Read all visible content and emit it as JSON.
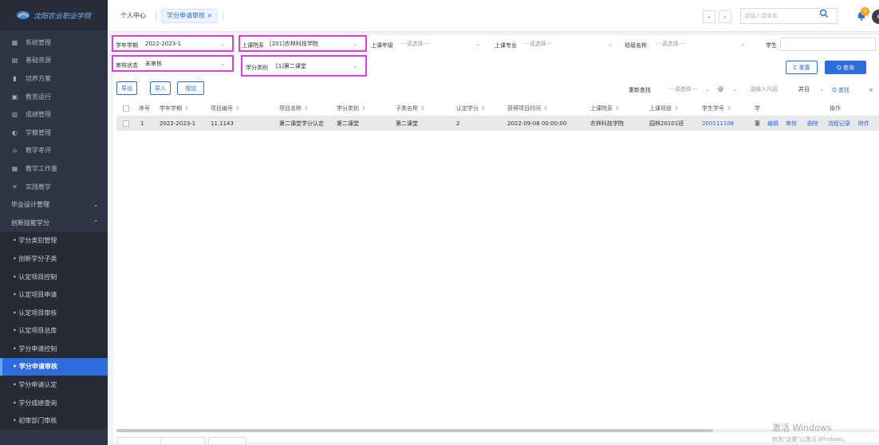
{
  "sidebar": {
    "logo_text": "沈阳农业职业学院",
    "items": [
      {
        "label": "系统管理",
        "icon": "settings-icon"
      },
      {
        "label": "基础资源",
        "icon": "database-icon"
      },
      {
        "label": "培养方案",
        "icon": "book-icon"
      },
      {
        "label": "教务运行",
        "icon": "monitor-icon"
      },
      {
        "label": "成绩管理",
        "icon": "score-icon"
      },
      {
        "label": "学籍管理",
        "icon": "student-icon"
      },
      {
        "label": "教学考评",
        "icon": "home-icon"
      },
      {
        "label": "教学工作量",
        "icon": "chart-icon"
      },
      {
        "label": "实践教学",
        "icon": "practice-icon"
      }
    ],
    "groups": [
      {
        "label": "毕业设计管理",
        "chevron": "chevron-down-icon"
      },
      {
        "label": "创新技能学分",
        "chevron": "chevron-up-icon"
      }
    ],
    "subitems": [
      {
        "label": "• 学分类别管理"
      },
      {
        "label": "• 创新学分子类"
      },
      {
        "label": "• 认定项目控制"
      },
      {
        "label": "• 认定项目申请"
      },
      {
        "label": "• 认定项目审核"
      },
      {
        "label": "• 认定项目总库"
      },
      {
        "label": "• 学分申请控制"
      },
      {
        "label": "• 学分申请审核"
      },
      {
        "label": "• 学分申请认定"
      },
      {
        "label": "• 学分成绩查询"
      },
      {
        "label": "• 初审部门审核"
      }
    ],
    "active_subitem": "• 学分申请审核"
  },
  "topbar": {
    "tabs": [
      {
        "label": "个人中心"
      },
      {
        "label": "学分申请审核 ×"
      }
    ],
    "menu_search_placeholder": "请输入菜单名",
    "notification_count": "0",
    "avatar": "e"
  },
  "filters": {
    "term_label": "学年学期",
    "term_value": "2022-2023-1",
    "college_label": "上课院系",
    "college_value": "[201]农林科技学院",
    "grade_label": "上课年级",
    "grade_value": "---请选择---",
    "major_label": "上课专业",
    "major_value": "---请选择---",
    "class_label": "班级名称",
    "class_value": "---请选择---",
    "student_label": "学生",
    "status_label": "审核状态",
    "status_value": "未审核",
    "category_label": "学分类别",
    "category_value": "[1]第二课堂",
    "reset_label": "C 重置",
    "query_label": "Q 查询"
  },
  "toolbar": {
    "export_label": "导出",
    "import_label": "导入",
    "add_label": "增加",
    "refresh_label": "重新查找",
    "field_select": "---请选择---",
    "operator": "@",
    "content_placeholder": "请输入内容",
    "logic_select": "并且",
    "find_label": "Q 查找"
  },
  "table": {
    "columns": [
      "序号",
      "学年学期",
      "项目编号",
      "项目名称",
      "学分类别",
      "子类名称",
      "认定学分",
      "获得项目时间",
      "上课院系",
      "上课班级",
      "学生学号",
      "学",
      "操作"
    ],
    "rows": [
      {
        "index": "1",
        "term": "2022-2023-1",
        "project_no": "11.1143",
        "project_name": "第二课堂学分认定",
        "category": "第二课堂",
        "sub_name": "第二课堂",
        "credit": "2",
        "time": "2022-09-08 00:00:00",
        "college": "农林科技学院",
        "class": "园林20101班",
        "student_no": "200111108",
        "name_partial": "董",
        "actions": [
          "编辑",
          "审核",
          "删除",
          "流程记录",
          "附件"
        ]
      }
    ]
  },
  "watermark": {
    "line1": "激活 Windows",
    "line2": "转到\"设置\"以激活 Windows。"
  },
  "colors": {
    "sidebar_bg": "#2f3544",
    "accent": "#2d6cdf",
    "highlight_box": "#e03cd9"
  }
}
